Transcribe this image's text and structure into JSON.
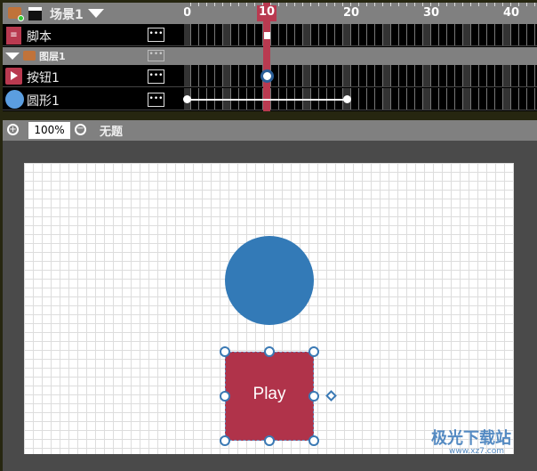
{
  "timeline": {
    "scene_label": "场景1",
    "frame_labels": [
      "0",
      "10",
      "20",
      "30",
      "40"
    ],
    "current_frame": 10,
    "total_visible_frames": 44,
    "rows": [
      {
        "name": "脚本",
        "type": "script"
      },
      {
        "name": "图层1",
        "type": "layer"
      },
      {
        "name": "按钮1",
        "type": "button"
      },
      {
        "name": "圆形1",
        "type": "shape",
        "tween_start": 0,
        "tween_end": 20
      }
    ],
    "more_label": "•••"
  },
  "toolbar": {
    "zoom": "100%",
    "title": "无题"
  },
  "stage": {
    "button_label": "Play",
    "circle_color": "#337ab7",
    "button_color": "#b0334a"
  },
  "watermark": {
    "text": "极光下载站",
    "url": "www.xz7.com"
  },
  "colors": {
    "accent": "#b93a50"
  }
}
